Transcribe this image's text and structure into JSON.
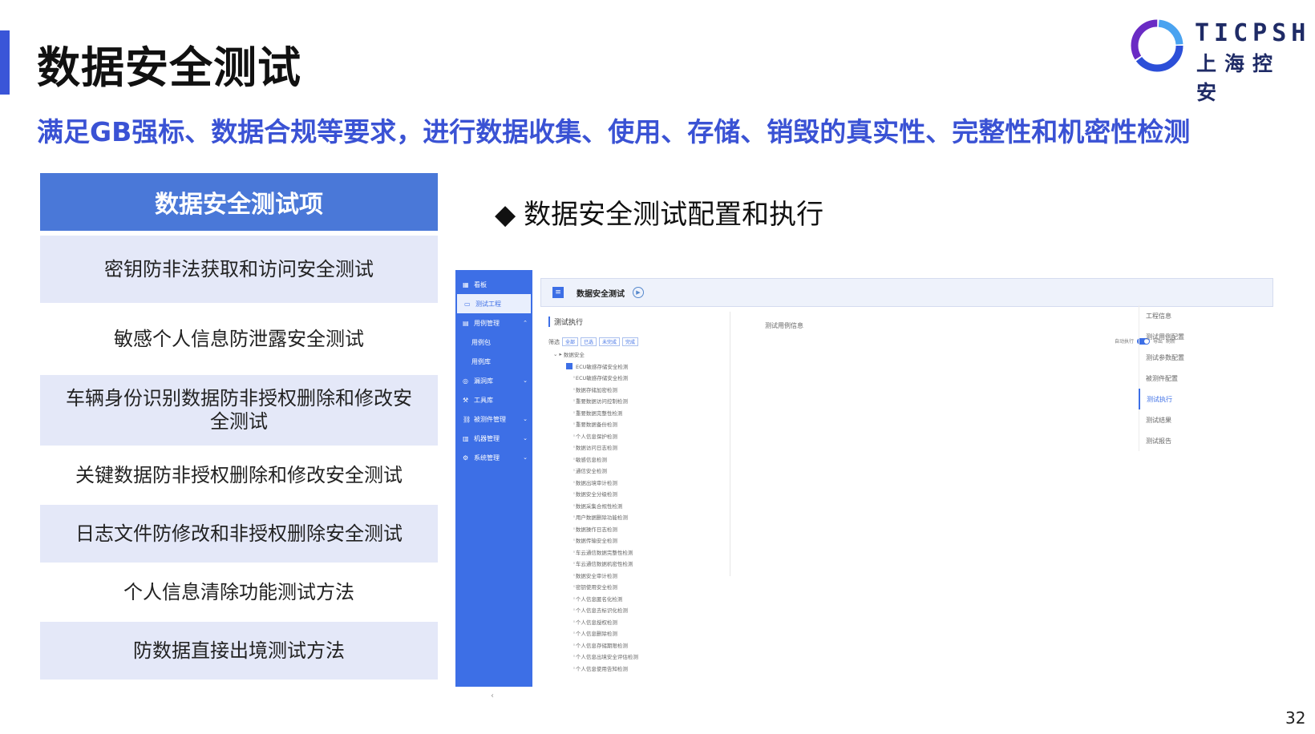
{
  "slide": {
    "title": "数据安全测试",
    "subtitle": "满足GB强标、数据合规等要求，进行数据收集、使用、存储、销毁的真实性、完整性和机密性检测",
    "page_number": "32",
    "accent_color": "#3a55d8"
  },
  "logo": {
    "en": "TICPSH",
    "cn": "上海控安"
  },
  "test_items": {
    "header": "数据安全测试项",
    "items": [
      "密钥防非法获取和访问安全测试",
      "敏感个人信息防泄露安全测试",
      "车辆身份识别数据防非授权删除和修改安全测试",
      "关键数据防非授权删除和修改安全测试",
      "日志文件防修改和非授权删除安全测试",
      "个人信息清除功能测试方法",
      "防数据直接出境测试方法"
    ]
  },
  "section": {
    "bullet": "◆",
    "title": "数据安全测试配置和执行"
  },
  "app": {
    "sidebar": [
      {
        "label": "看板",
        "icon": "grid-icon"
      },
      {
        "label": "测试工程",
        "icon": "monitor-icon",
        "active": true
      },
      {
        "label": "用例管理",
        "icon": "file-icon",
        "caret": "⌃"
      },
      {
        "label": "用例包",
        "sub": true
      },
      {
        "label": "用例库",
        "sub": true
      },
      {
        "label": "漏洞库",
        "icon": "shield-icon",
        "caret": "⌄"
      },
      {
        "label": "工具库",
        "icon": "wrench-icon"
      },
      {
        "label": "被测件管理",
        "icon": "link-icon",
        "caret": "⌄"
      },
      {
        "label": "机器管理",
        "icon": "server-icon",
        "caret": "⌄"
      },
      {
        "label": "系统管理",
        "icon": "gear-icon",
        "caret": "⌄"
      }
    ],
    "collapse_glyph": "‹",
    "header_title": "数据安全测试",
    "exec_label": "测试执行",
    "tree_toolbar": {
      "label": "筛选",
      "buttons": [
        "全部",
        "已选",
        "未完成",
        "完成"
      ]
    },
    "tree": {
      "root": "数据安全",
      "group": "ECU敏感存储安全检测",
      "leaves": [
        "ECU敏感存储安全检测",
        "数据存储加密检测",
        "重要数据访问控制检测",
        "重要数据完整性检测",
        "重要数据备份检测",
        "个人信息保护检测",
        "数据访问日志检测",
        "敏感信息检测",
        "通信安全检测",
        "数据出境审计检测",
        "数据安全分级检测",
        "数据采集合规性检测",
        "用户数据删除功能检测",
        "数据操作日志检测",
        "数据传输安全检测",
        "车云通信数据完整性检测",
        "车云通信数据机密性检测",
        "数据安全审计检测",
        "密钥使用安全检测",
        "个人信息匿名化检测",
        "个人信息去标识化检测",
        "个人信息授权检测",
        "个人信息删除检测",
        "个人信息存储期限检测",
        "个人信息出境安全评估检测",
        "个人信息使用告知检测"
      ]
    },
    "info_label": "测试用例信息",
    "options": {
      "auto_label": "自动执行",
      "export": "导出",
      "refresh": "刷新"
    },
    "right_nav": [
      "工程信息",
      "测试用例配置",
      "测试参数配置",
      "被测件配置",
      "测试执行",
      "测试结果",
      "测试报告"
    ],
    "right_nav_active": 4
  }
}
